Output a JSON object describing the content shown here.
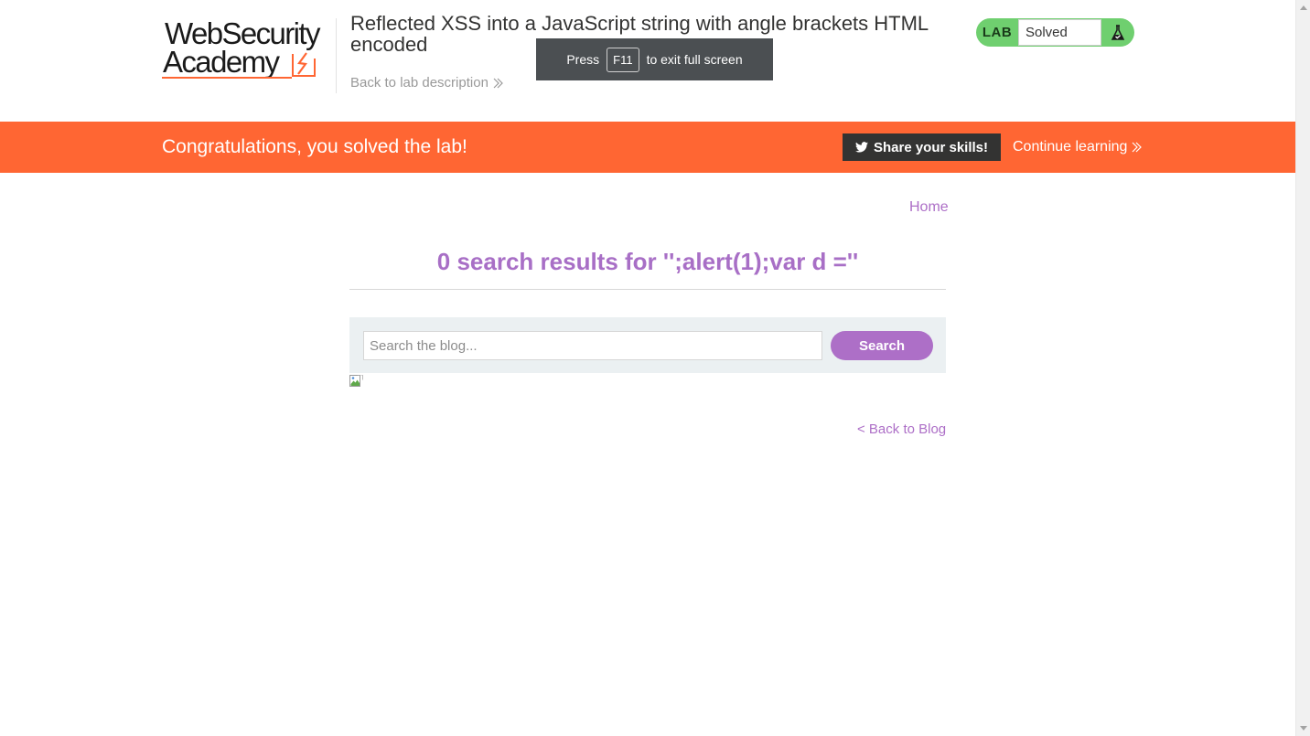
{
  "header": {
    "logo_line1": "WebSecurity",
    "logo_line2": "Academy",
    "lab_title": "Reflected XSS into a JavaScript string with angle brackets HTML encoded",
    "back_to_description": "Back to lab description",
    "lab_status": {
      "label": "LAB",
      "value": "Solved",
      "icon": "flask-icon"
    }
  },
  "fullscreen_toast": {
    "prefix": "Press",
    "key": "F11",
    "suffix": "to exit full screen"
  },
  "banner": {
    "message": "Congratulations, you solved the lab!",
    "share_label": "Share your skills!",
    "share_icon": "twitter-icon",
    "continue_label": "Continue learning"
  },
  "nav": {
    "home": "Home"
  },
  "results": {
    "heading": "0 search results for '';alert(1);var d =''"
  },
  "search": {
    "placeholder": "Search the blog...",
    "value": "",
    "button_label": "Search"
  },
  "footer": {
    "back_to_blog": "< Back to Blog"
  },
  "colors": {
    "accent": "#ff6633",
    "link": "#ad6fc7",
    "solved_green": "#6fcf6f",
    "dark": "#333332"
  }
}
